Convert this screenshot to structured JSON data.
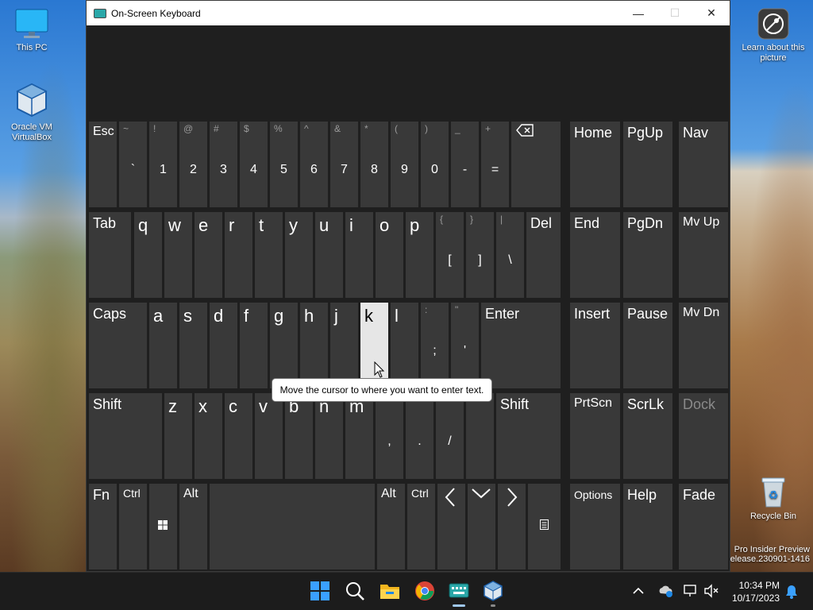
{
  "desktop": {
    "icons": [
      {
        "label": "This PC"
      },
      {
        "label": "Oracle VM VirtualBox"
      },
      {
        "label": "Learn about this picture"
      },
      {
        "label": "Recycle Bin"
      }
    ],
    "watermark_line1": "Pro Insider Preview",
    "watermark_line2": "elease.230901-1416"
  },
  "window": {
    "title": "On-Screen Keyboard",
    "minimize": "—",
    "maximize": "☐",
    "close": "✕"
  },
  "keys": {
    "esc": "Esc",
    "backtick_shift": "~",
    "backtick": "`",
    "n1_shift": "!",
    "n1": "1",
    "n2_shift": "@",
    "n2": "2",
    "n3_shift": "#",
    "n3": "3",
    "n4_shift": "$",
    "n4": "4",
    "n5_shift": "%",
    "n5": "5",
    "n6_shift": "^",
    "n6": "6",
    "n7_shift": "&",
    "n7": "7",
    "n8_shift": "*",
    "n8": "8",
    "n9_shift": "(",
    "n9": "9",
    "n0_shift": ")",
    "n0": "0",
    "minus_shift": "_",
    "minus": "-",
    "equals_shift": "+",
    "equals": "=",
    "home": "Home",
    "pgup": "PgUp",
    "nav": "Nav",
    "tab": "Tab",
    "q": "q",
    "w": "w",
    "e": "e",
    "r": "r",
    "t": "t",
    "y": "y",
    "u": "u",
    "i": "i",
    "o": "o",
    "p": "p",
    "lbracket_shift": "{",
    "lbracket": "[",
    "rbracket_shift": "}",
    "rbracket": "]",
    "backslash_shift": "|",
    "backslash": "\\",
    "del": "Del",
    "end": "End",
    "pgdn": "PgDn",
    "mvup": "Mv Up",
    "caps": "Caps",
    "a": "a",
    "s": "s",
    "d": "d",
    "f": "f",
    "g": "g",
    "h": "h",
    "j": "j",
    "k": "k",
    "l": "l",
    "semicolon_shift": ":",
    "semicolon": ";",
    "quote_shift": "\"",
    "quote": "'",
    "enter": "Enter",
    "insert": "Insert",
    "pause": "Pause",
    "mvdn": "Mv Dn",
    "shift_left": "Shift",
    "z": "z",
    "x": "x",
    "c": "c",
    "v": "v",
    "b": "b",
    "n": "n",
    "m": "m",
    "comma": ",",
    "period": ".",
    "slash": "/",
    "shift_right": "Shift",
    "prtscn": "PrtScn",
    "scrlk": "ScrLk",
    "dock": "Dock",
    "fn": "Fn",
    "ctrl_left": "Ctrl",
    "alt_left": "Alt",
    "alt_right": "Alt",
    "ctrl_right": "Ctrl",
    "options": "Options",
    "help": "Help",
    "fade": "Fade"
  },
  "tooltip": "Move the cursor to where you want to enter text.",
  "taskbar": {
    "time": "10:34 PM",
    "date": "10/17/2023"
  },
  "colors": {
    "key_bg": "#393939",
    "key_active": "#e6e6e6",
    "window_bg": "#1f1f1f",
    "taskbar_bg": "#1c1c1c",
    "accent": "#0067c0"
  }
}
